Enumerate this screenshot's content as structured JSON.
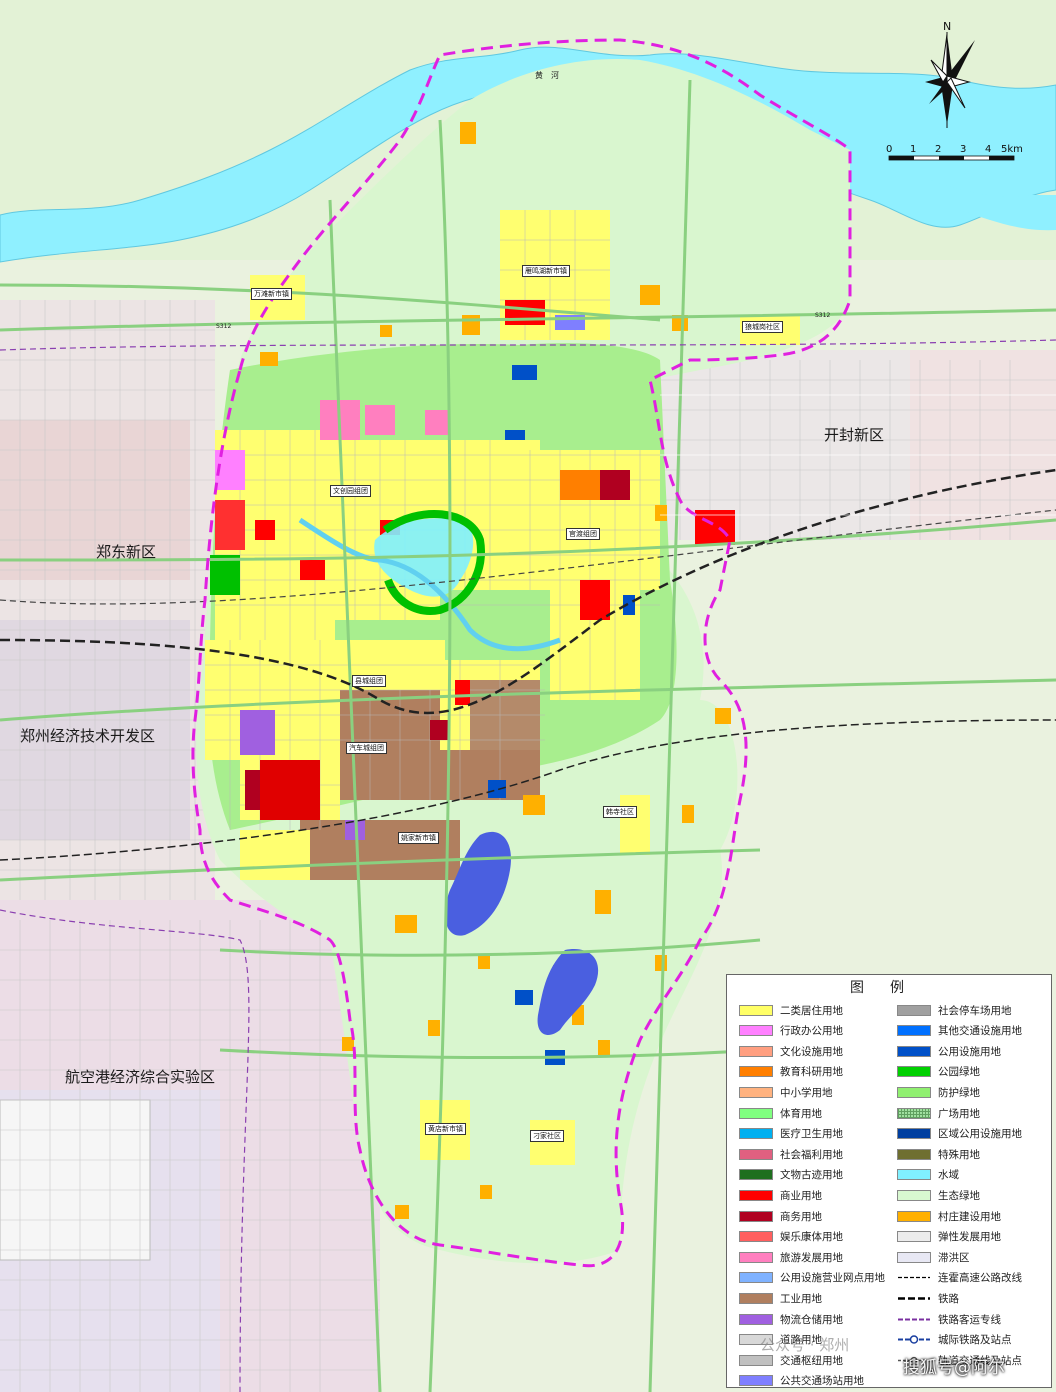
{
  "map": {
    "river_label": "黄　河",
    "districts": {
      "kaifeng": "开封新区",
      "zhengdong": "郑东新区",
      "jingkai": "郑州经济技术开发区",
      "hangkonggang": "航空港经济综合实验区"
    },
    "towns": {
      "wantan": "万滩新市镇",
      "yanminghu": "雁鸣湖新市镇",
      "langchengang": "狼城岗社区",
      "wenchuang": "文创园组团",
      "guandu": "官渡组团",
      "xiancheng": "县城组团",
      "qiche": "汽车城组团",
      "yaojia": "姚家新市镇",
      "hanzhuang": "韩寺社区",
      "huangdian": "黄店新市镇",
      "diaojia": "刁家社区"
    },
    "roads": {
      "s312a": "S312",
      "s312b": "S312"
    }
  },
  "compass": {
    "north_label": "N"
  },
  "scale": {
    "ticks": [
      "0",
      "1",
      "2",
      "3",
      "4",
      "5km"
    ]
  },
  "legend": {
    "title": "图例",
    "left_items": [
      {
        "label": "二类居住用地",
        "color": "#ffff66"
      },
      {
        "label": "行政办公用地",
        "color": "#ff80ff"
      },
      {
        "label": "文化设施用地",
        "color": "#ff9f80"
      },
      {
        "label": "教育科研用地",
        "color": "#ff7f00"
      },
      {
        "label": "中小学用地",
        "color": "#ffb27f"
      },
      {
        "label": "体育用地",
        "color": "#80ff80"
      },
      {
        "label": "医疗卫生用地",
        "color": "#00b0f0"
      },
      {
        "label": "社会福利用地",
        "color": "#e06080"
      },
      {
        "label": "文物古迹用地",
        "color": "#1f6f1f"
      },
      {
        "label": "商业用地",
        "color": "#ff0000"
      },
      {
        "label": "商务用地",
        "color": "#b00020"
      },
      {
        "label": "娱乐康体用地",
        "color": "#ff5f5f"
      },
      {
        "label": "旅游发展用地",
        "color": "#ff7fbf"
      },
      {
        "label": "公用设施营业网点用地",
        "color": "#7fb2ff"
      },
      {
        "label": "工业用地",
        "color": "#b07f5f"
      },
      {
        "label": "物流仓储用地",
        "color": "#a060e0"
      },
      {
        "label": "道路用地",
        "color": "#d8d8d8"
      },
      {
        "label": "交通枢纽用地",
        "color": "#c0c0c0"
      },
      {
        "label": "公共交通场站用地",
        "color": "#7f7fff"
      }
    ],
    "right_items": [
      {
        "label": "社会停车场用地",
        "color": "#a0a0a0",
        "kind": "fill"
      },
      {
        "label": "其他交通设施用地",
        "color": "#0070ff",
        "kind": "fill"
      },
      {
        "label": "公用设施用地",
        "color": "#0050c8",
        "kind": "fill"
      },
      {
        "label": "公园绿地",
        "color": "#00d000",
        "kind": "fill"
      },
      {
        "label": "防护绿地",
        "color": "#90f070",
        "kind": "fill"
      },
      {
        "label": "广场用地",
        "color": "#a0e0a0",
        "kind": "grid"
      },
      {
        "label": "区域公用设施用地",
        "color": "#003fa0",
        "kind": "fill"
      },
      {
        "label": "特殊用地",
        "color": "#6f6f30",
        "kind": "fill"
      },
      {
        "label": "水域",
        "color": "#80f0ff",
        "kind": "fill"
      },
      {
        "label": "生态绿地",
        "color": "#d8f8d0",
        "kind": "fill"
      },
      {
        "label": "村庄建设用地",
        "color": "#ffb000",
        "kind": "fill"
      },
      {
        "label": "弹性发展用地",
        "color": "#ececec",
        "kind": "fill"
      },
      {
        "label": "滞洪区",
        "color": "#e8e8f4",
        "kind": "fill"
      },
      {
        "label": "连霍高速公路改线",
        "color": "#000000",
        "kind": "dash"
      },
      {
        "label": "铁路",
        "color": "#000000",
        "kind": "rail"
      },
      {
        "label": "铁路客运专线",
        "color": "#7a2fa0",
        "kind": "hsr"
      },
      {
        "label": "城际铁路及站点",
        "color": "#1a3fa0",
        "kind": "intercity"
      },
      {
        "label": "轨道交通线及站点",
        "color": "#555555",
        "kind": "metro"
      }
    ]
  },
  "watermarks": {
    "sohu": "搜狐号@阿尔",
    "wechat": "公众号 · 郑州"
  }
}
